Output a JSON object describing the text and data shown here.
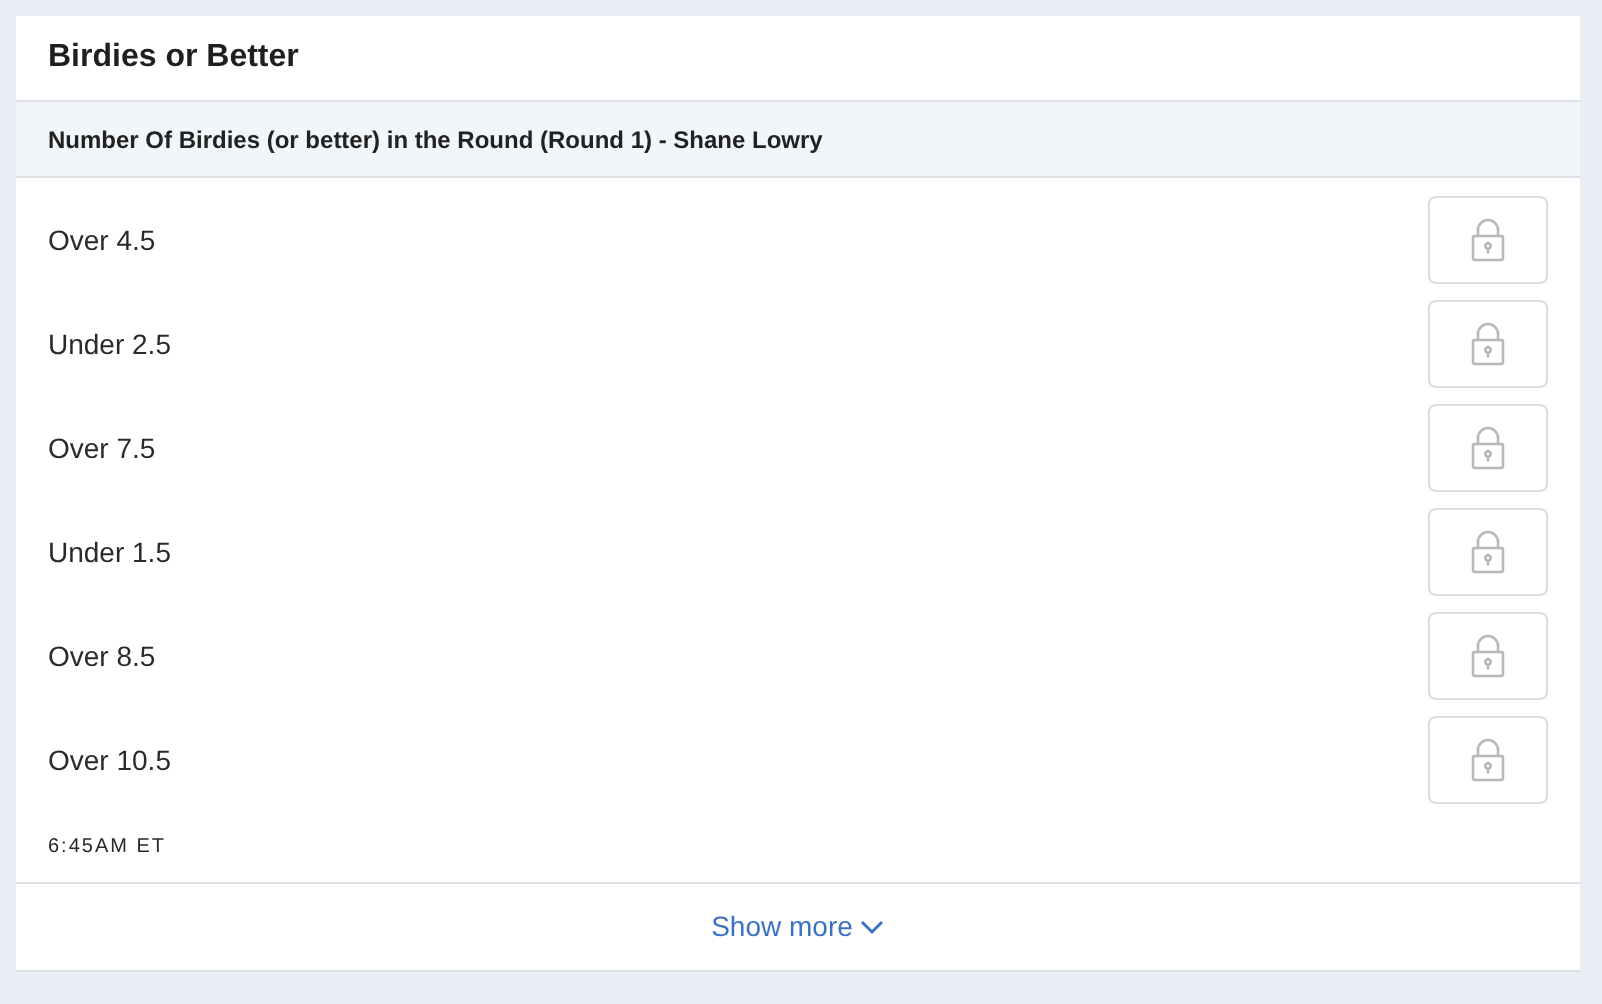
{
  "title": "Birdies or Better",
  "market": "Number Of Birdies (or better) in the Round (Round 1) - Shane Lowry",
  "options": [
    {
      "label": "Over 4.5",
      "locked": true
    },
    {
      "label": "Under 2.5",
      "locked": true
    },
    {
      "label": "Over 7.5",
      "locked": true
    },
    {
      "label": "Under 1.5",
      "locked": true
    },
    {
      "label": "Over 8.5",
      "locked": true
    },
    {
      "label": "Over 10.5",
      "locked": true
    }
  ],
  "time": "6:45AM ET",
  "show_more": "Show more"
}
